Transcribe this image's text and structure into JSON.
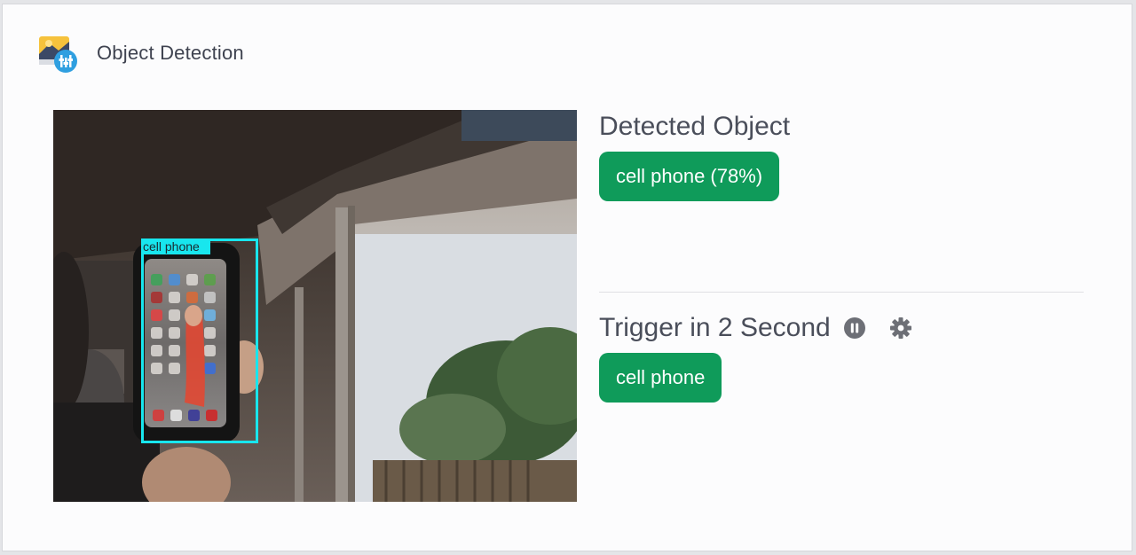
{
  "app": {
    "icon": "image-detection-icon",
    "title": "Object Detection"
  },
  "camera": {
    "detections": [
      {
        "label": "cell phone"
      }
    ],
    "box_color": "#18e6ee"
  },
  "detected": {
    "heading": "Detected Object",
    "result_label": "cell phone (78%)"
  },
  "trigger": {
    "heading": "Trigger in 2 Second",
    "pause_icon": "pause-circle-icon",
    "settings_icon": "gear-icon",
    "value_label": "cell phone"
  },
  "colors": {
    "badge": "#0f9b5a",
    "heading": "#4a4e5a",
    "icon_gray": "#6d6f76"
  }
}
